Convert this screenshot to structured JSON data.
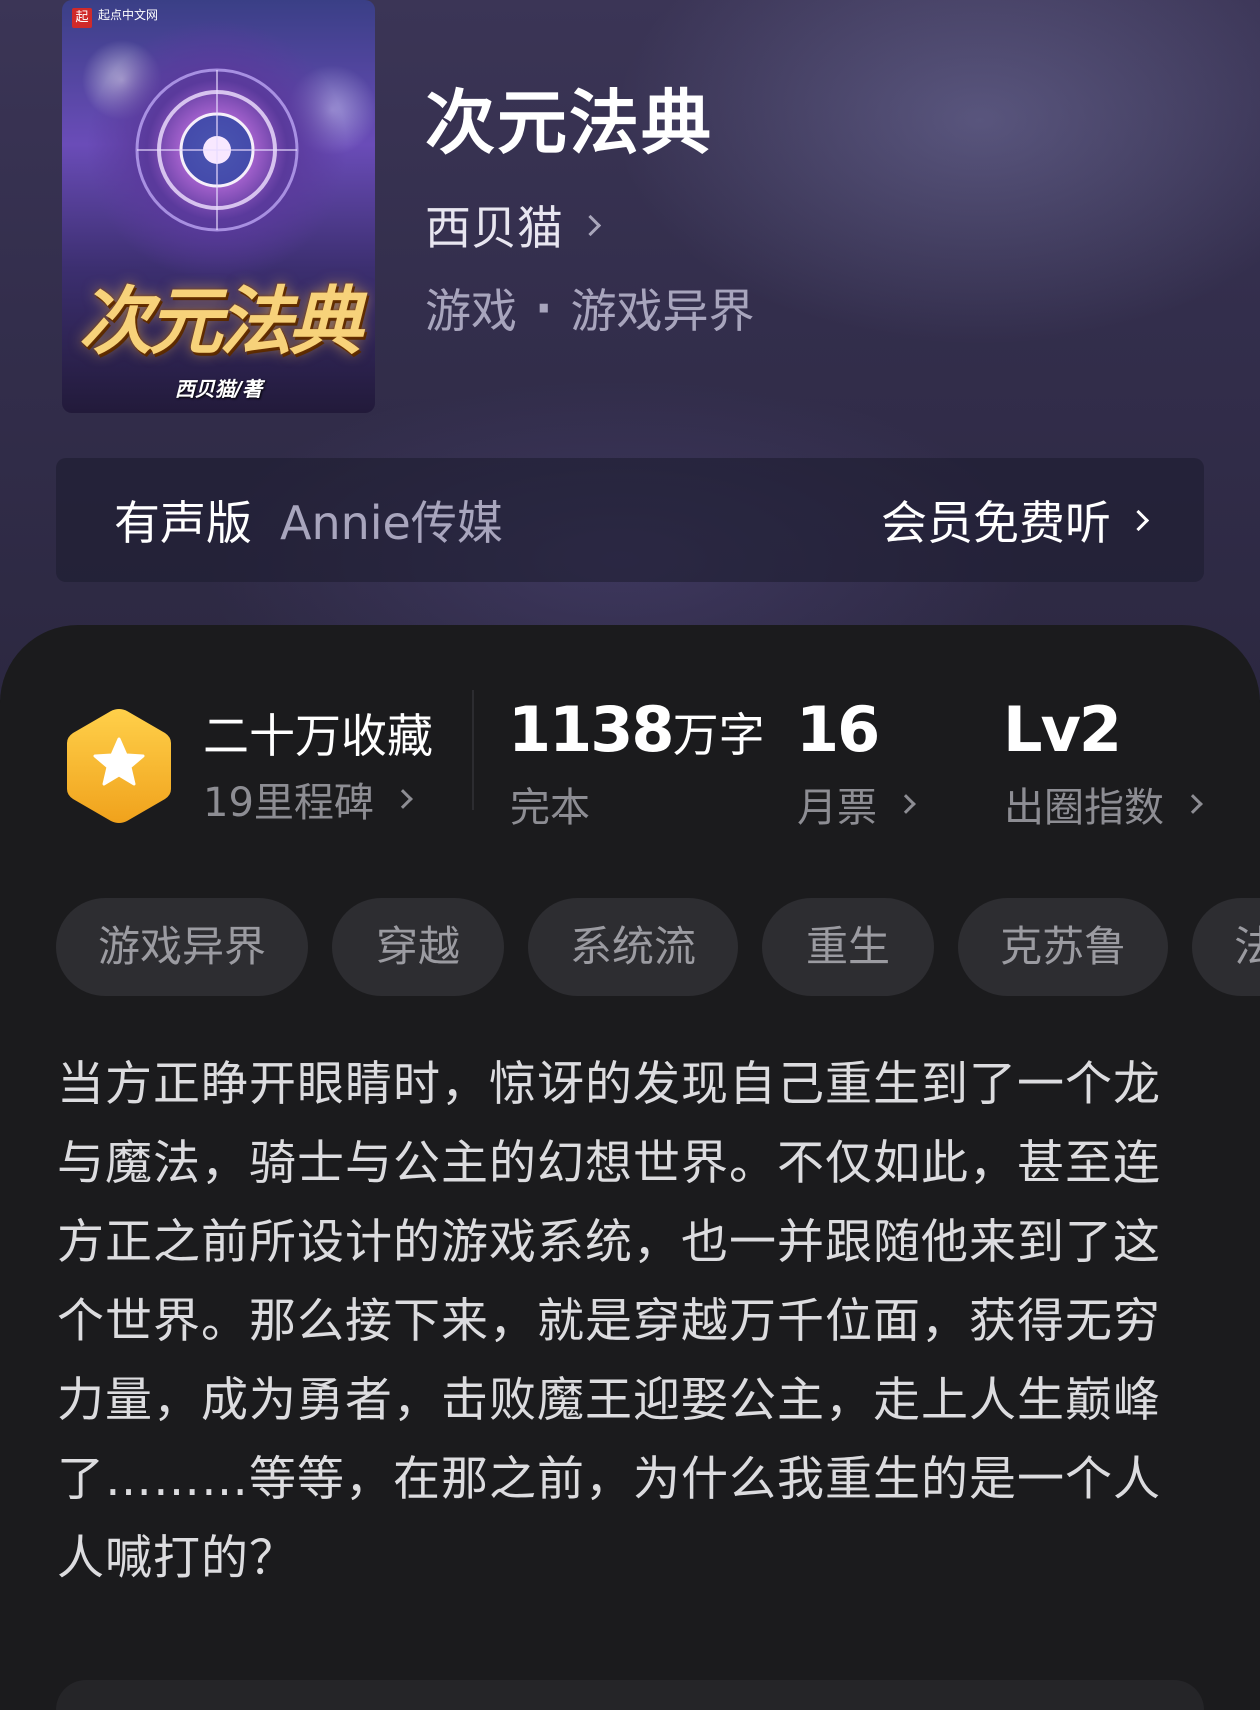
{
  "cover": {
    "badge": "起",
    "site": "起点中文网",
    "title": "次元法典",
    "author": "西贝猫/著"
  },
  "book": {
    "title": "次元法典",
    "author": "西贝猫",
    "genre_main": "游戏",
    "genre_separator": "·",
    "genre_sub": "游戏异界"
  },
  "audio": {
    "label": "有声版",
    "company": "Annie传媒",
    "action": "会员免费听"
  },
  "stats": {
    "collect": {
      "title": "二十万收藏",
      "milestone": "19里程碑"
    },
    "words": {
      "value": "1138",
      "unit": "万字",
      "label": "完本"
    },
    "monthly": {
      "value": "16",
      "label": "月票"
    },
    "influence": {
      "value": "Lv2",
      "label": "出圈指数"
    }
  },
  "tags": [
    "游戏异界",
    "穿越",
    "系统流",
    "重生",
    "克苏鲁",
    "法师"
  ],
  "description": "当方正睁开眼睛时，惊讶的发现自己重生到了一个龙与魔法，骑士与公主的幻想世界。不仅如此，甚至连方正之前所设计的游戏系统，也一并跟随他来到了这个世界。那么接下来，就是穿越万千位面，获得无穷力量，成为勇者，击败魔王迎娶公主，走上人生巅峰了………等等，在那之前，为什么我重生的是一个人人喊打的？",
  "colors": {
    "badge_gold": "#f5b82a",
    "panel_bg": "#1b1b1d",
    "tag_bg": "#2d2d31"
  }
}
